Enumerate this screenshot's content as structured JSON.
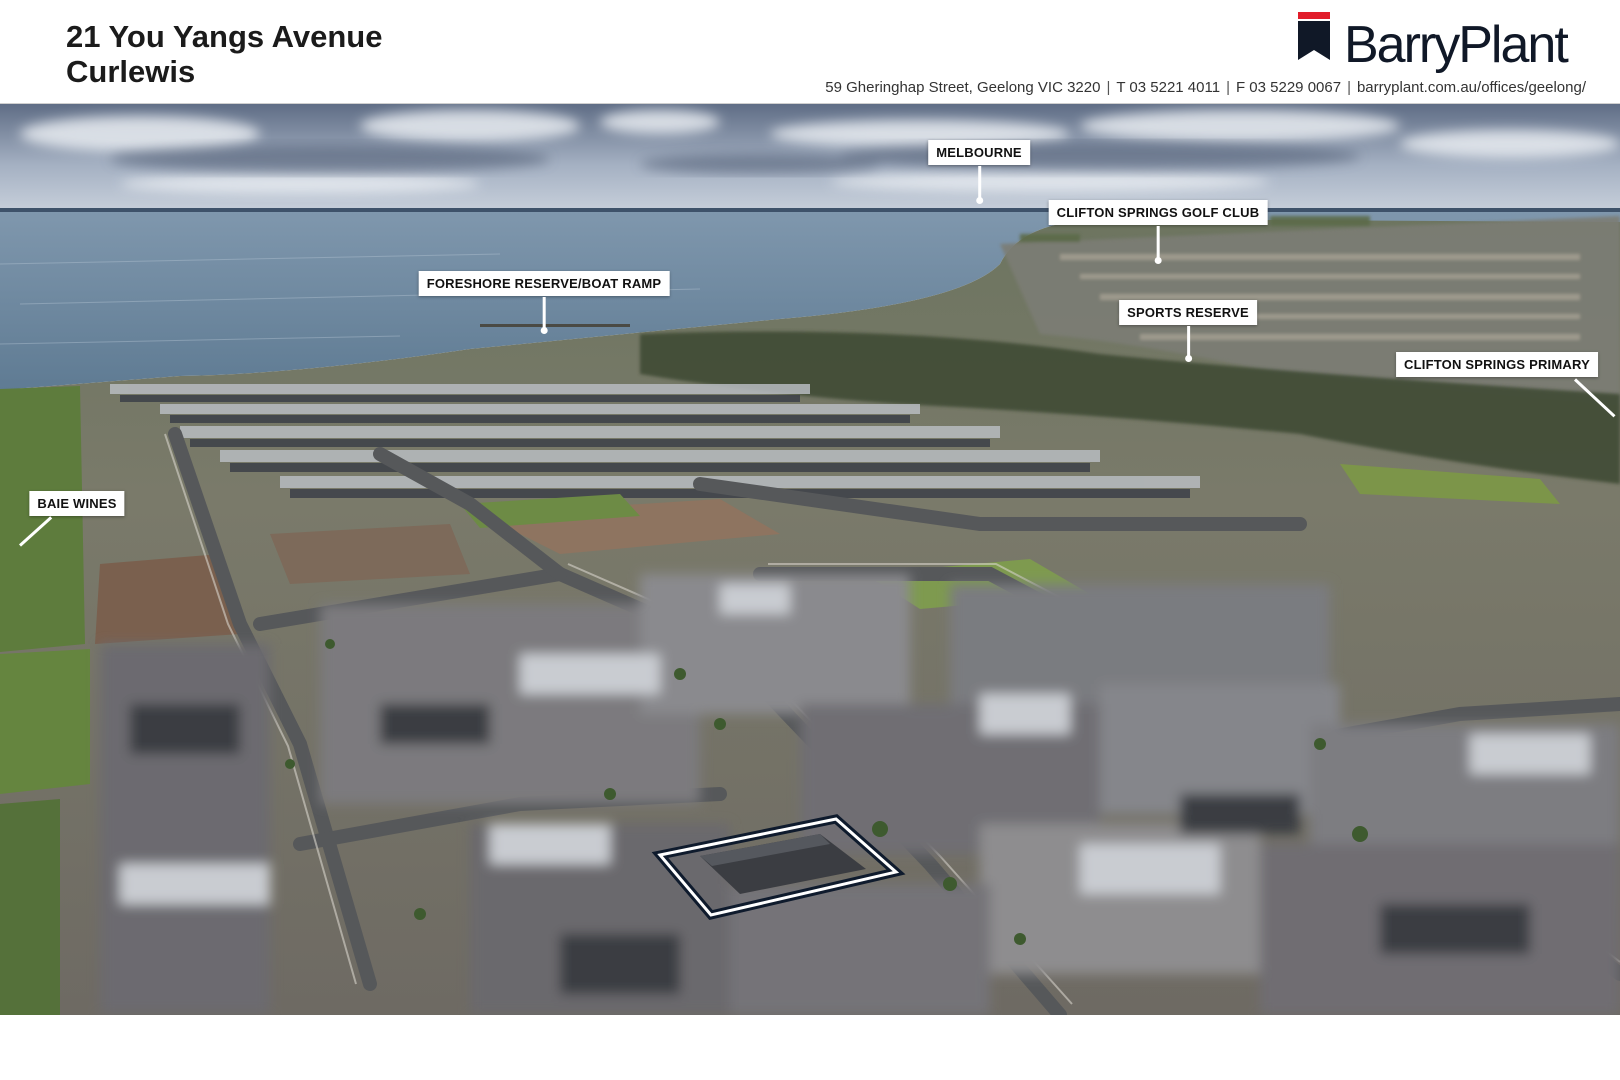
{
  "header": {
    "address_line1": "21 You Yangs Avenue",
    "address_line2": "Curlewis",
    "logo_text": "BarryPlant",
    "logo_icon": "flag-icon",
    "office_address": "59 Gheringhap Street, Geelong VIC 3220",
    "phone": "T 03 5221 4011",
    "fax": "F 03 5229 0067",
    "website": "barryplant.com.au/offices/geelong/",
    "separator": "|"
  },
  "map_labels": {
    "melbourne": "MELBOURNE",
    "clifton_springs_golf_club": "CLIFTON SPRINGS GOLF CLUB",
    "foreshore_reserve": "FORESHORE RESERVE/BOAT RAMP",
    "sports_reserve": "SPORTS RESERVE",
    "clifton_springs_primary": "CLIFTON SPRINGS PRIMARY",
    "baie_wines": "BAIE WINES"
  },
  "colors": {
    "brand_navy": "#101827",
    "brand_red": "#e11d2a",
    "label_background": "#ffffff",
    "highlight_outline": "#0f1b2d"
  }
}
